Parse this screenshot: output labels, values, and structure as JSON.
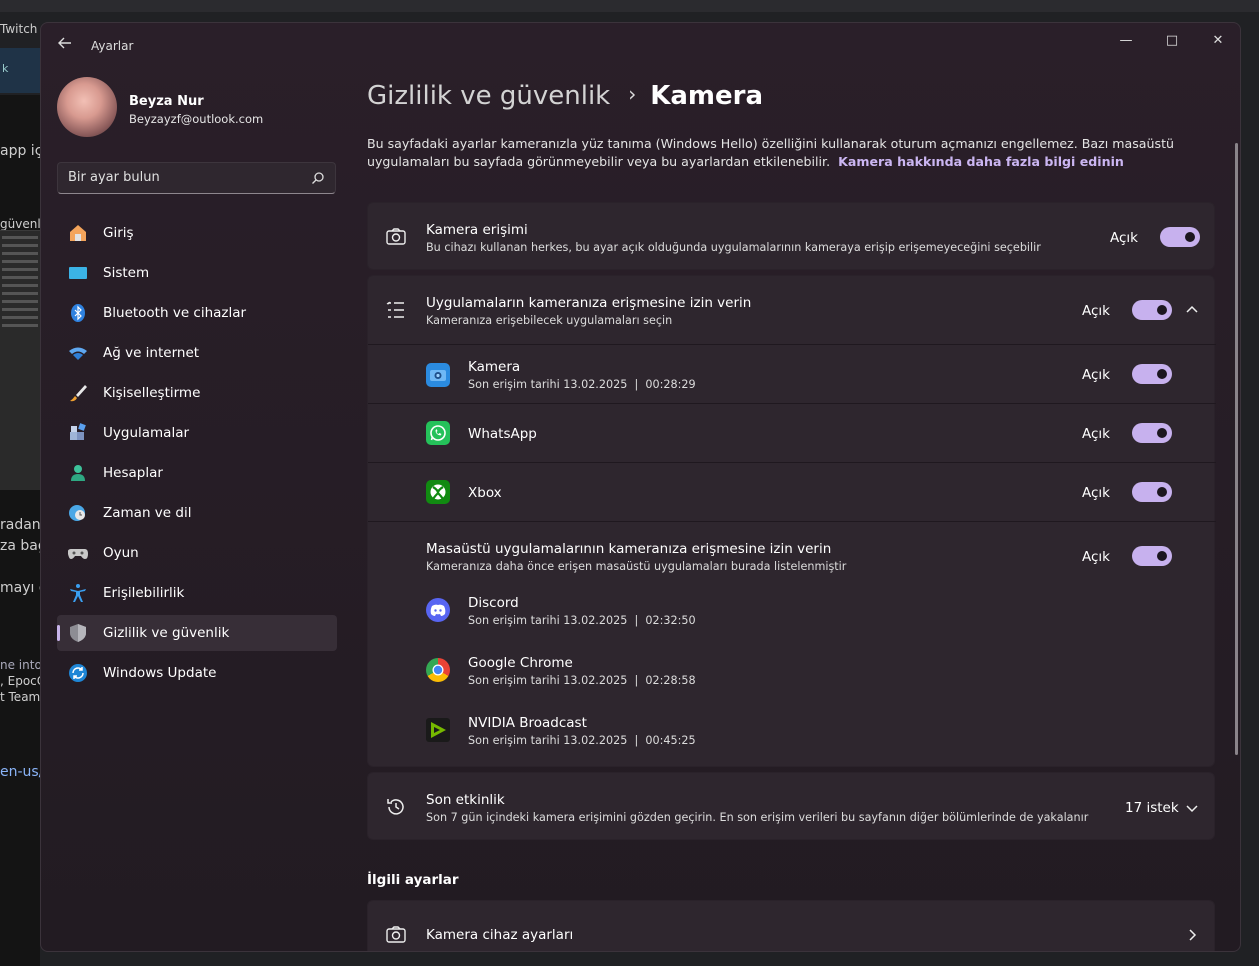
{
  "background": {
    "tab_label": "Twitch",
    "strip_text": "k",
    "texts": [
      "app iç",
      "güvenlik",
      "radan",
      "za bağ",
      "mayı d",
      "ne into",
      ", EpocC",
      "t Teams",
      "en-us/"
    ]
  },
  "window": {
    "title": "Ayarlar",
    "controls": {
      "minimize": "—",
      "maximize": "□",
      "close": "✕"
    }
  },
  "user": {
    "name": "Beyza Nur",
    "email": "Beyzayzf@outlook.com"
  },
  "search": {
    "placeholder": "Bir ayar bulun"
  },
  "nav": [
    {
      "label": "Giriş",
      "icon": "home-icon"
    },
    {
      "label": "Sistem",
      "icon": "monitor-icon"
    },
    {
      "label": "Bluetooth ve cihazlar",
      "icon": "bluetooth-icon"
    },
    {
      "label": "Ağ ve internet",
      "icon": "wifi-icon"
    },
    {
      "label": "Kişiselleştirme",
      "icon": "brush-icon"
    },
    {
      "label": "Uygulamalar",
      "icon": "apps-icon"
    },
    {
      "label": "Hesaplar",
      "icon": "person-icon"
    },
    {
      "label": "Zaman ve dil",
      "icon": "clock-globe-icon"
    },
    {
      "label": "Oyun",
      "icon": "gamepad-icon"
    },
    {
      "label": "Erişilebilirlik",
      "icon": "accessibility-icon"
    },
    {
      "label": "Gizlilik ve güvenlik",
      "icon": "shield-icon",
      "active": true
    },
    {
      "label": "Windows Update",
      "icon": "update-icon"
    }
  ],
  "page": {
    "breadcrumb_parent": "Gizlilik ve güvenlik",
    "breadcrumb_separator": "›",
    "breadcrumb_current": "Kamera",
    "description": "Bu sayfadaki ayarlar kameranızla yüz tanıma (Windows Hello) özelliğini kullanarak oturum açmanızı engellemez. Bazı masaüstü uygulamaları bu sayfada görünmeyebilir veya bu ayarlardan etkilenebilir.",
    "learn_more": "Kamera hakkında daha fazla bilgi edinin"
  },
  "camera_access": {
    "title": "Kamera erişimi",
    "subtitle": "Bu cihazı kullanan herkes, bu ayar açık olduğunda uygulamalarının kameraya erişip erişemeyeceğini seçebilir",
    "state": "Açık"
  },
  "apps_access": {
    "title": "Uygulamaların kameranıza erişmesine izin verin",
    "subtitle": "Kameranıza erişebilecek uygulamaları seçin",
    "state": "Açık",
    "apps": [
      {
        "name": "Kamera",
        "last_access": "Son erişim tarihi 13.02.2025  |  00:28:29",
        "state": "Açık"
      },
      {
        "name": "WhatsApp",
        "last_access": "",
        "state": "Açık"
      },
      {
        "name": "Xbox",
        "last_access": "",
        "state": "Açık"
      }
    ]
  },
  "desktop_access": {
    "title": "Masaüstü uygulamalarının kameranıza erişmesine izin verin",
    "subtitle": "Kameranıza daha önce erişen masaüstü uygulamaları burada listelenmiştir",
    "state": "Açık",
    "apps": [
      {
        "name": "Discord",
        "last_access": "Son erişim tarihi 13.02.2025  |  02:32:50"
      },
      {
        "name": "Google Chrome",
        "last_access": "Son erişim tarihi 13.02.2025  |  02:28:58"
      },
      {
        "name": "NVIDIA Broadcast",
        "last_access": "Son erişim tarihi 13.02.2025  |  00:45:25"
      }
    ]
  },
  "recent_activity": {
    "title": "Son etkinlik",
    "subtitle": "Son 7 gün içindeki kamera erişimini gözden geçirin. En son erişim verileri bu sayfanın diğer bölümlerinde de yakalanır",
    "count": "17 istek"
  },
  "related": {
    "heading": "İlgili ayarlar",
    "items": [
      {
        "title": "Kamera cihaz ayarları"
      }
    ]
  },
  "colors": {
    "accent": "#c7b1ee",
    "link": "#cbb6f2",
    "card": "#2e262e"
  }
}
